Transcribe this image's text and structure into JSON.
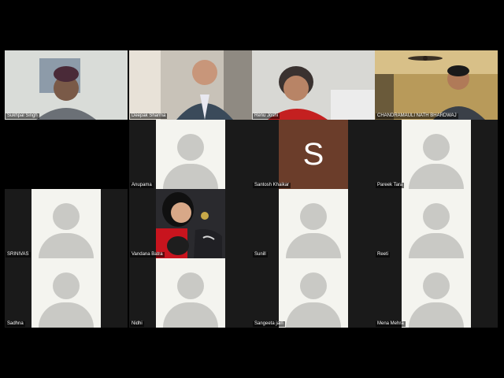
{
  "participants": [
    {
      "name": "Sukhpal Singh",
      "type": "video",
      "scene": "man-turban"
    },
    {
      "name": "Deepak Sharma",
      "type": "video",
      "scene": "man-suit"
    },
    {
      "name": "Renu Joshi",
      "type": "video",
      "scene": "woman-reading"
    },
    {
      "name": "CHANDRAMAULI NATH BHARDWAJ",
      "type": "video",
      "scene": "man-ceiling-fan"
    },
    {
      "name": "",
      "type": "empty"
    },
    {
      "name": "Anupama",
      "type": "avatar"
    },
    {
      "name": "Santosh Khaikar",
      "type": "initial",
      "initial": "S",
      "color": "#6b3d2a"
    },
    {
      "name": "Pareek Tara",
      "type": "avatar"
    },
    {
      "name": "SRINIVAS",
      "type": "avatar"
    },
    {
      "name": "Vandana Batra",
      "type": "video",
      "scene": "woman-selfie"
    },
    {
      "name": "Sunill",
      "type": "avatar"
    },
    {
      "name": "Reeti",
      "type": "avatar"
    },
    {
      "name": "Sadhna",
      "type": "avatar"
    },
    {
      "name": "Nidhi",
      "type": "avatar"
    },
    {
      "name": "Sangeeta jain",
      "type": "avatar"
    },
    {
      "name": "Mena Mehra",
      "type": "avatar"
    }
  ],
  "colors": {
    "background": "#000000",
    "tile": "#1a1a1a",
    "avatar_bg": "#f4f4ef",
    "avatar_shape": "#c9c9c5"
  }
}
